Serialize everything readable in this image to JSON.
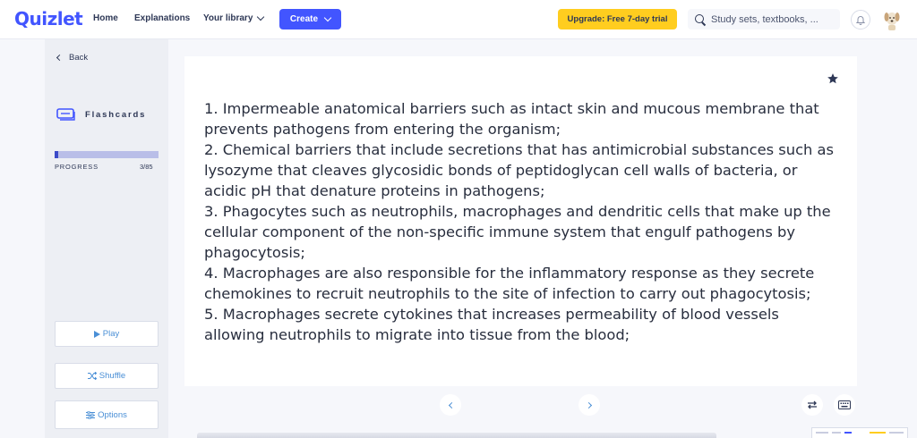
{
  "header": {
    "logo": "Quizlet",
    "nav": {
      "home": "Home",
      "explanations": "Explanations",
      "library": "Your library"
    },
    "create_label": "Create",
    "upgrade_label": "Upgrade: Free 7-day trial",
    "search_placeholder": "Study sets, textbooks, ...",
    "icons": [
      "search-icon",
      "bell-icon",
      "avatar"
    ],
    "colors": {
      "brand": "#4255ff",
      "upgrade": "#ffcd1f"
    }
  },
  "sidebar": {
    "back_label": "Back",
    "mode_label": "Flashcards",
    "progress": {
      "label": "PROGRESS",
      "count": "3/85",
      "current": 3,
      "total": 85
    },
    "buttons": {
      "play": "Play",
      "shuffle": "Shuffle",
      "options": "Options"
    }
  },
  "card": {
    "lines": [
      "1. Impermeable anatomical barriers such as intact skin and mucous membrane that prevents pathogens from entering the organism;",
      "2. Chemical barriers that include secretions that has antimicrobial substances such as lysozyme that cleaves glycosidic bonds of peptidoglycan cell walls of bacteria, or acidic pH that denature proteins in pathogens;",
      "3. Phagocytes such as neutrophils, macrophages and dendritic cells that make up the cellular component of the non-specific immune system that engulf pathogens by phagocytosis;",
      "4. Macrophages are also responsible for the inflammatory response as they secrete chemokines to recruit neutrophils to the site of infection to carry out phagocytosis;",
      "5. Macrophages secrete cytokines that increases permeability of blood vessels allowing neutrophils to migrate into tissue from the blood;"
    ]
  },
  "controls": {
    "icons": [
      "prev-arrow-icon",
      "next-arrow-icon",
      "swap-icon",
      "keyboard-icon",
      "star-icon"
    ]
  }
}
